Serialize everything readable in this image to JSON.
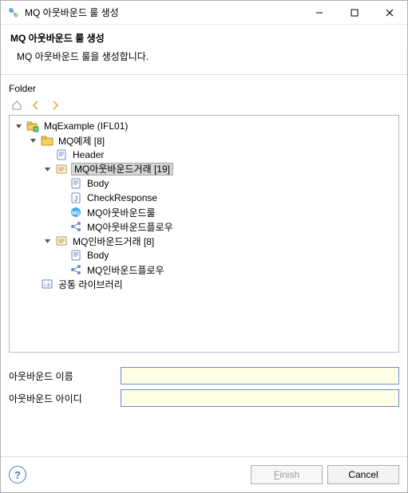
{
  "window": {
    "title": "MQ 아웃바운드 룰 생성",
    "icon_name": "wizard-icon"
  },
  "head": {
    "title": "MQ 아웃바운드 룰 생성",
    "subtitle": "MQ 아웃바운드 룰을 생성합니다."
  },
  "labels": {
    "folder": "Folder",
    "outbound_name": "아웃바운드 이름",
    "outbound_id": "아웃바운드 아이디"
  },
  "fields": {
    "outbound_name": {
      "value": "",
      "placeholder": ""
    },
    "outbound_id": {
      "value": "",
      "placeholder": ""
    }
  },
  "buttons": {
    "finish": "Finish",
    "finish_mnemonic": "F",
    "cancel": "Cancel"
  },
  "toolbar": {
    "home": "home-icon",
    "back": "back-icon",
    "forward": "forward-icon"
  },
  "tree": {
    "root": {
      "label": "MqExample  (IFL01)",
      "icon": "project-icon",
      "expanded": true,
      "children": [
        {
          "label": "MQ예제 [8]",
          "icon": "biz-folder-icon",
          "expanded": true,
          "children": [
            {
              "label": "Header",
              "icon": "file-icon",
              "leaf": true
            },
            {
              "label": "MQ아웃바운드거래 [19]",
              "icon": "folder-outline-icon",
              "expanded": true,
              "selected": true,
              "children": [
                {
                  "label": "Body",
                  "icon": "file-icon",
                  "leaf": true
                },
                {
                  "label": "CheckResponse",
                  "icon": "js-file-icon",
                  "leaf": true
                },
                {
                  "label": "MQ아웃바운드룰",
                  "icon": "mq-rule-icon",
                  "leaf": true
                },
                {
                  "label": "MQ아웃바운드플로우",
                  "icon": "flow-icon",
                  "leaf": true
                }
              ]
            },
            {
              "label": "MQ인바운드거래 [8]",
              "icon": "folder-outline-icon",
              "expanded": true,
              "children": [
                {
                  "label": "Body",
                  "icon": "file-icon",
                  "leaf": true
                },
                {
                  "label": "MQ인바운드플로우",
                  "icon": "flow-icon",
                  "leaf": true
                }
              ]
            }
          ]
        },
        {
          "label": "공통 라이브러리",
          "icon": "lib-icon",
          "leaf": true
        }
      ]
    }
  },
  "colors": {
    "accent": "#4a78bd",
    "input_bg": "#ffffe6",
    "selection_bg": "#d6d6d6"
  }
}
